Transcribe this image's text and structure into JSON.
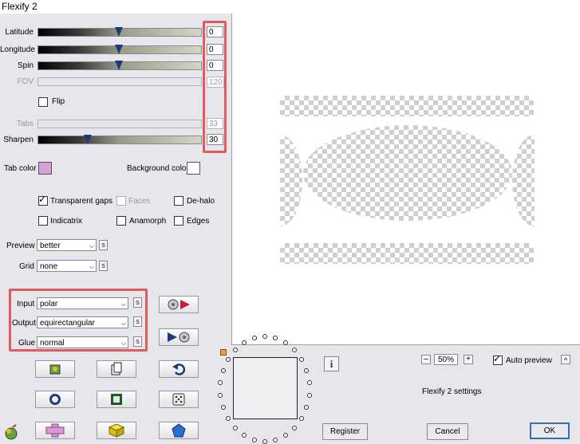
{
  "window": {
    "title": "Flexify 2"
  },
  "sliders": {
    "latitude": {
      "label": "Latitude",
      "value": "0",
      "level": 0.5
    },
    "longitude": {
      "label": "Longitude",
      "value": "0",
      "level": 0.5
    },
    "spin": {
      "label": "Spin",
      "value": "0",
      "level": 0.5
    },
    "fov": {
      "label": "FOV",
      "value": "120",
      "disabled": true
    },
    "tabs": {
      "label": "Tabs",
      "value": "33",
      "disabled": true
    },
    "sharpen": {
      "label": "Sharpen",
      "value": "30",
      "level": 0.3
    }
  },
  "flip": {
    "label": "Flip",
    "checked": false
  },
  "colors": {
    "tab_color_label": "Tab color",
    "tab_color": "#d8a0d8",
    "background_color_label": "Background color",
    "background_color": "#ffffff"
  },
  "options": {
    "transparent_gaps": {
      "label": "Transparent gaps",
      "checked": true
    },
    "faces": {
      "label": "Faces",
      "checked": false,
      "disabled": true
    },
    "de_halo": {
      "label": "De-halo",
      "checked": false
    },
    "indicatrix": {
      "label": "Indicatrix",
      "checked": false
    },
    "anamorph": {
      "label": "Anamorph",
      "checked": false
    },
    "edges": {
      "label": "Edges",
      "checked": false
    }
  },
  "selects": {
    "preview": {
      "label": "Preview",
      "value": "better"
    },
    "grid": {
      "label": "Grid",
      "value": "none"
    },
    "input": {
      "label": "Input",
      "value": "polar"
    },
    "output": {
      "label": "Output",
      "value": "equirectangular"
    },
    "glue": {
      "label": "Glue",
      "value": "normal"
    }
  },
  "s_label": "S",
  "zoom": {
    "minus": "–",
    "value": "50%",
    "plus": "+"
  },
  "auto_preview": {
    "label": "Auto preview",
    "checked": true,
    "toggle": "^"
  },
  "info_icon": "i",
  "settings_label": "Flexify 2 settings",
  "buttons": {
    "register": "Register",
    "cancel": "Cancel",
    "ok": "OK"
  }
}
